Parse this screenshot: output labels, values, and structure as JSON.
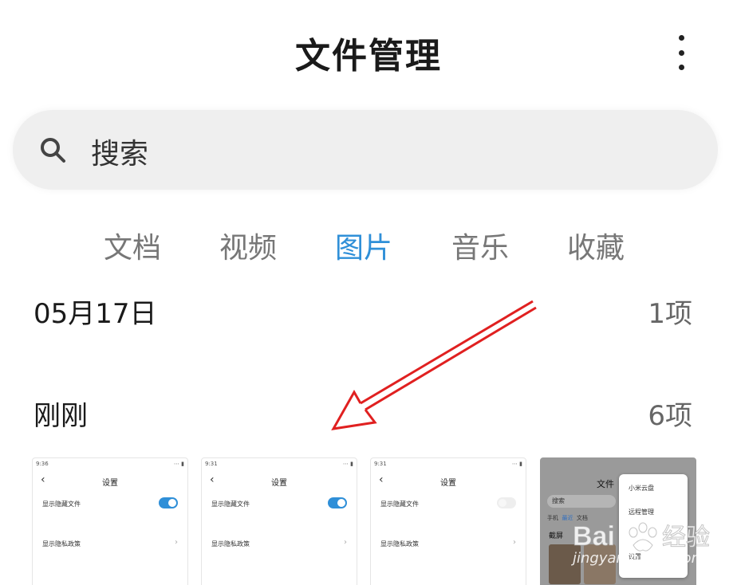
{
  "header": {
    "title": "文件管理",
    "more_icon": "more-vertical-icon"
  },
  "search": {
    "placeholder": "搜索",
    "icon": "search-icon"
  },
  "tabs": [
    {
      "label": "文档",
      "active": false
    },
    {
      "label": "视频",
      "active": false
    },
    {
      "label": "图片",
      "active": true
    },
    {
      "label": "音乐",
      "active": false
    },
    {
      "label": "收藏",
      "active": false
    }
  ],
  "sections": [
    {
      "title": "05月17日",
      "count": "1项"
    },
    {
      "title": "刚刚",
      "count": "6项"
    }
  ],
  "thumbnails": [
    {
      "time": "9:36",
      "title": "设置",
      "row1": "显示隐藏文件",
      "row2": "显示隐私政策",
      "toggle_on": true
    },
    {
      "time": "9:31",
      "title": "设置",
      "row1": "显示隐藏文件",
      "row2": "显示隐私政策",
      "toggle_on": true
    },
    {
      "time": "9:31",
      "title": "设置",
      "row1": "显示隐藏文件",
      "row2": "显示隐私政策",
      "toggle_on": false
    },
    {
      "title": "文件",
      "search": "搜索",
      "tabs": [
        "手机",
        "最近",
        "文档"
      ],
      "sub": "截屏",
      "menu": [
        "小米云盘",
        "远程管理",
        "设置"
      ]
    }
  ],
  "colors": {
    "accent": "#2f8fd8",
    "annotation_arrow": "#e02020"
  },
  "watermark": {
    "logo": "Bai度经验",
    "url": "jingyan.baidu.com"
  }
}
